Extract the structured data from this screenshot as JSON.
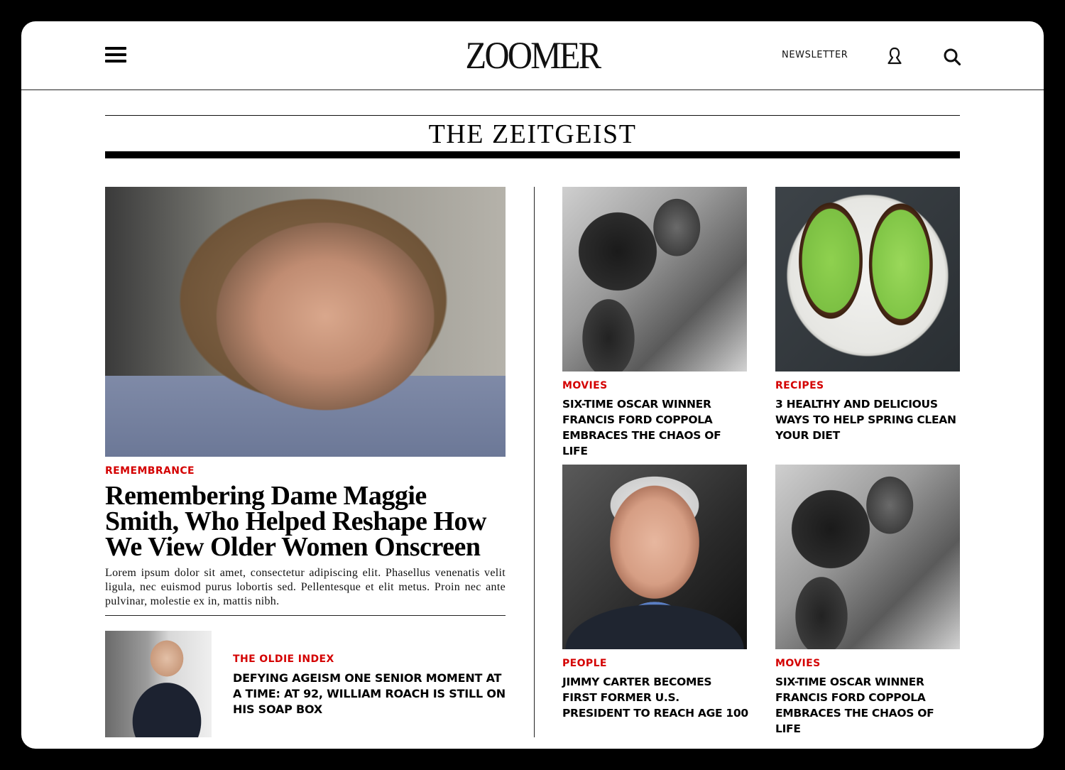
{
  "header": {
    "logo": "ZOOMER",
    "newsletter_label": "NEWSLETTER"
  },
  "section": {
    "title": "THE ZEITGEIST"
  },
  "feature": {
    "category": "REMEMBRANCE",
    "headline": "Remembering Dame Maggie Smith, Who Helped Reshape How We View Older Women Onscreen",
    "excerpt": "Lorem ipsum dolor sit amet, consectetur adipiscing elit. Phasellus venenatis velit ligula, nec euismod purus lobortis sed. Pellentesque et elit metus. Proin nec ante pulvinar, molestie ex in, mattis nibh."
  },
  "secondary": {
    "category": "THE OLDIE INDEX",
    "headline": "DEFYING AGEISM ONE SENIOR MOMENT AT A TIME: AT 92, WILLIAM ROACH IS STILL ON HIS SOAP BOX"
  },
  "cards": [
    {
      "category": "MOVIES",
      "headline": "SIX-TIME OSCAR WINNER FRANCIS  FORD COPPOLA EMBRACES THE CHAOS OF LIFE"
    },
    {
      "category": "RECIPES",
      "headline": "3 HEALTHY AND DELICIOUS WAYS TO HELP SPRING CLEAN YOUR DIET"
    },
    {
      "category": "PEOPLE",
      "headline": "JIMMY CARTER BECOMES FIRST FORMER U.S. PRESIDENT TO REACH AGE 100"
    },
    {
      "category": "MOVIES",
      "headline": "SIX-TIME OSCAR WINNER FRANCIS  FORD COPPOLA EMBRACES THE CHAOS OF LIFE"
    }
  ],
  "colors": {
    "accent": "#d40000",
    "text": "#000000",
    "background": "#ffffff",
    "frame": "#000000"
  },
  "icons": {
    "menu": "hamburger-menu-icon",
    "user": "user-icon",
    "search": "search-icon"
  }
}
